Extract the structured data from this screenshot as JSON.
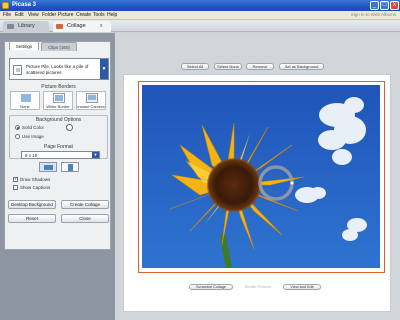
{
  "window": {
    "title": "Picasa 3",
    "controls": {
      "minimize": "_",
      "maximize": "□",
      "close": "x"
    }
  },
  "menu": {
    "items": [
      "File",
      "Edit",
      "View",
      "Folder",
      "Picture",
      "Create",
      "Tools",
      "Help"
    ],
    "signin": "Sign in to Web Albums"
  },
  "mode_tabs": {
    "library": "Library",
    "collage": "Collage",
    "collage_close": "x"
  },
  "panel": {
    "tabs": {
      "settings": "Settings",
      "clips": "Clips (160)"
    },
    "preset": {
      "text": "Picture Pile:  Looks like a pile of scattered pictures",
      "arrow": "▼"
    },
    "borders": {
      "title": "Picture Borders",
      "options": [
        "None",
        "White Border",
        "Instant Camera"
      ]
    },
    "background": {
      "title": "Background Options",
      "solid_label": "Solid Color",
      "image_label": "Use Image"
    },
    "format": {
      "title": "Page Format",
      "value": "8 x 10",
      "arrow": "▼"
    },
    "checks": {
      "shadows": "Draw Shadows",
      "captions": "Show Captions"
    },
    "buttons": {
      "desktop": "Desktop Background",
      "create": "Create Collage",
      "reset": "Reset",
      "close": "Close"
    }
  },
  "toolbar": {
    "select_all": "Select All",
    "select_none": "Select None",
    "remove": "Remove",
    "set_background": "Set as Background"
  },
  "bottom_bar": {
    "scramble": "Scramble Collage",
    "shuffle": "Shuffle Pictures",
    "view_edit": "View and Edit"
  },
  "colors": {
    "titlebar": "#1e56c2",
    "accent_frame": "#d7623a",
    "panel_bg": "#8e97a1",
    "workspace_bg": "#d2d5d9"
  },
  "icons": {
    "app": "picasa-icon",
    "library": "folder-icon",
    "collage": "collage-icon",
    "preset": "picture-pile-icon",
    "landscape": "landscape-icon",
    "portrait": "portrait-icon"
  }
}
